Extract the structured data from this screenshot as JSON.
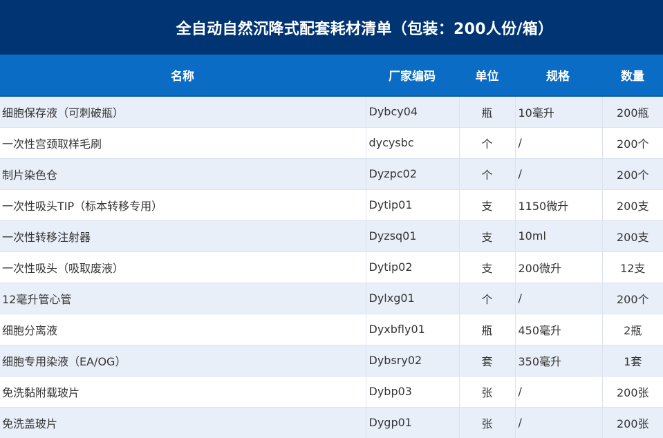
{
  "title": "全自动自然沉降式配套耗材清单（包装：200人份/箱）",
  "headers": {
    "name": "名称",
    "code": "厂家编码",
    "unit": "单位",
    "spec": "规格",
    "qty": "数量"
  },
  "rows": [
    {
      "name": "细胞保存液（可刺破瓶）",
      "code": "Dybcy04",
      "unit": "瓶",
      "spec": "10毫升",
      "qty": "200瓶"
    },
    {
      "name": "一次性宫颈取样毛刷",
      "code": "dycysbc",
      "unit": "个",
      "spec": "/",
      "qty": "200个"
    },
    {
      "name": "制片染色仓",
      "code": "Dyzpc02",
      "unit": "个",
      "spec": "/",
      "qty": "200个"
    },
    {
      "name": "一次性吸头TIP（标本转移专用）",
      "code": "Dytip01",
      "unit": "支",
      "spec": "1150微升",
      "qty": "200支"
    },
    {
      "name": "一次性转移注射器",
      "code": "Dyzsq01",
      "unit": "支",
      "spec": "10ml",
      "qty": "200支"
    },
    {
      "name": "一次性吸头（吸取废液）",
      "code": "Dytip02",
      "unit": "支",
      "spec": "200微升",
      "qty": "12支"
    },
    {
      "name": "12毫升管心管",
      "code": "Dylxg01",
      "unit": "个",
      "spec": "/",
      "qty": "200个"
    },
    {
      "name": "细胞分离液",
      "code": "Dyxbfly01",
      "unit": "瓶",
      "spec": "450毫升",
      "qty": "2瓶"
    },
    {
      "name": "细胞专用染液（EA/OG）",
      "code": "Dybsry02",
      "unit": "套",
      "spec": "350毫升",
      "qty": "1套"
    },
    {
      "name": "免洗黏附载玻片",
      "code": "Dybp03",
      "unit": "张",
      "spec": "/",
      "qty": "200张"
    },
    {
      "name": "免洗盖玻片",
      "code": "Dygp01",
      "unit": "张",
      "spec": "/",
      "qty": "200张"
    }
  ]
}
